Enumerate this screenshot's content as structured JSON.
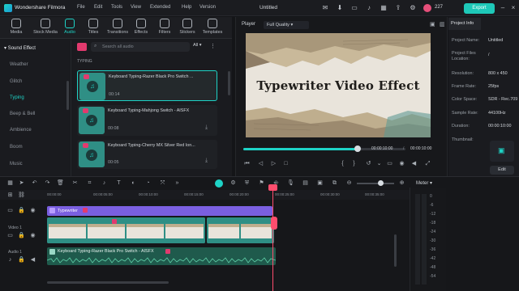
{
  "app": {
    "name": "Wondershare Filmora",
    "project_title": "Untitled",
    "time": "227",
    "export_label": "Export"
  },
  "menu": [
    "File",
    "Edit",
    "Tools",
    "View",
    "Extended",
    "Help",
    "Version"
  ],
  "tabs": [
    {
      "label": "Media",
      "icon": "media-icon"
    },
    {
      "label": "Stock Media",
      "icon": "stock-icon"
    },
    {
      "label": "Audio",
      "icon": "audio-icon"
    },
    {
      "label": "Titles",
      "icon": "titles-icon"
    },
    {
      "label": "Transitions",
      "icon": "transitions-icon"
    },
    {
      "label": "Effects",
      "icon": "effects-icon"
    },
    {
      "label": "Filters",
      "icon": "filters-icon"
    },
    {
      "label": "Stickers",
      "icon": "stickers-icon"
    },
    {
      "label": "Templates",
      "icon": "templates-icon"
    }
  ],
  "active_tab": "Audio",
  "sidebar": {
    "header": "Sound Effect",
    "items": [
      "Weather",
      "Glitch",
      "Typing",
      "Beep & Bell",
      "Ambience",
      "Boom",
      "Music"
    ],
    "selected": "Typing"
  },
  "search": {
    "placeholder": "Search all audio",
    "filter": "All"
  },
  "section_label": "TYPING",
  "audio_items": [
    {
      "name": "Keyboard Typing-Razer Black Pro Switch ...",
      "duration": "00:14",
      "selected": true
    },
    {
      "name": "Keyboard Typing-Mahjong Switch - AISFX",
      "duration": "00:08",
      "selected": false
    },
    {
      "name": "Keyboard Typing-Cherry MX Silver Red Ion...",
      "duration": "00:05",
      "selected": false
    }
  ],
  "player": {
    "label": "Player",
    "quality": "Full Quality",
    "video_title": "Typewriter Video Effect",
    "current_time": "00:00:10:00",
    "total_time": "00:00:10:00",
    "progress": 1.0
  },
  "project_info": {
    "tab": "Project Info",
    "rows": [
      {
        "label": "Project Name:",
        "value": "Untitled"
      },
      {
        "label": "Project Files Location:",
        "value": "/"
      },
      {
        "label": "Resolution:",
        "value": "800 x 450"
      },
      {
        "label": "Frame Rate:",
        "value": "25fps"
      },
      {
        "label": "Color Space:",
        "value": "SDR - Rec.709"
      },
      {
        "label": "Sample Rate:",
        "value": "44100Hz"
      },
      {
        "label": "Duration:",
        "value": "00:00:10:00"
      },
      {
        "label": "Thumbnail:",
        "value": ""
      }
    ],
    "edit_label": "Edit"
  },
  "timeline": {
    "ruler": [
      "00:00:00",
      "00:00:05:00",
      "00:00:10:00",
      "00:00:15:00",
      "00:00:20:00",
      "00:00:25:00",
      "00:00:30:00",
      "00:00:35:00",
      "00:00:40:00",
      "00:00:45:00"
    ],
    "meter_label": "Meter",
    "meter_scale": [
      "0",
      "-6",
      "-12",
      "-18",
      "-24",
      "-30",
      "-36",
      "-42",
      "-48",
      "-54"
    ],
    "tracks": [
      {
        "label": "Video 1"
      },
      {
        "label": "Audio 1"
      }
    ],
    "title_clip": "Typewriter",
    "audio_clip": "Keyboard Typing-Razer Black Pro Switch - AISFX"
  }
}
